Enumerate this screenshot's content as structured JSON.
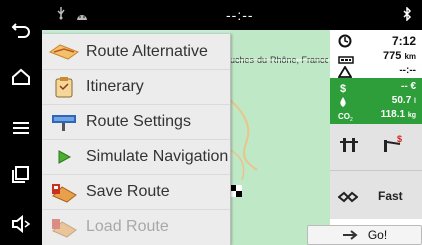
{
  "statusbar": {
    "time": "--:--",
    "icons": [
      "usb-icon",
      "android-debug-icon",
      "bluetooth-icon"
    ]
  },
  "navbar": {
    "buttons": [
      "back-icon",
      "home-icon",
      "menu-icon",
      "recent-apps-icon",
      "volume-icon"
    ]
  },
  "map": {
    "region_label": "uches-du-Rhône, France"
  },
  "menu": {
    "items": [
      {
        "label": "Route Alternative",
        "icon": "route-alternative-icon",
        "enabled": true
      },
      {
        "label": "Itinerary",
        "icon": "itinerary-icon",
        "enabled": true
      },
      {
        "label": "Route Settings",
        "icon": "route-settings-icon",
        "enabled": true
      },
      {
        "label": "Simulate Navigation",
        "icon": "simulate-play-icon",
        "enabled": true
      },
      {
        "label": "Save Route",
        "icon": "save-route-icon",
        "enabled": true
      },
      {
        "label": "Load Route",
        "icon": "load-route-icon",
        "enabled": false
      }
    ]
  },
  "panel": {
    "arrival_time": "7:12",
    "distance": {
      "value": "775",
      "unit": "km"
    },
    "warning": "--:--",
    "cost": {
      "value": "-- €"
    },
    "fuel": {
      "value": "50.7",
      "unit": "l"
    },
    "co2": {
      "value": "118.1",
      "unit": "kg"
    },
    "route_type": "Fast",
    "go_label": "Go!"
  },
  "colors": {
    "green": "#2e9e3a",
    "map": "#c6ead3",
    "menu": "#ececec"
  }
}
